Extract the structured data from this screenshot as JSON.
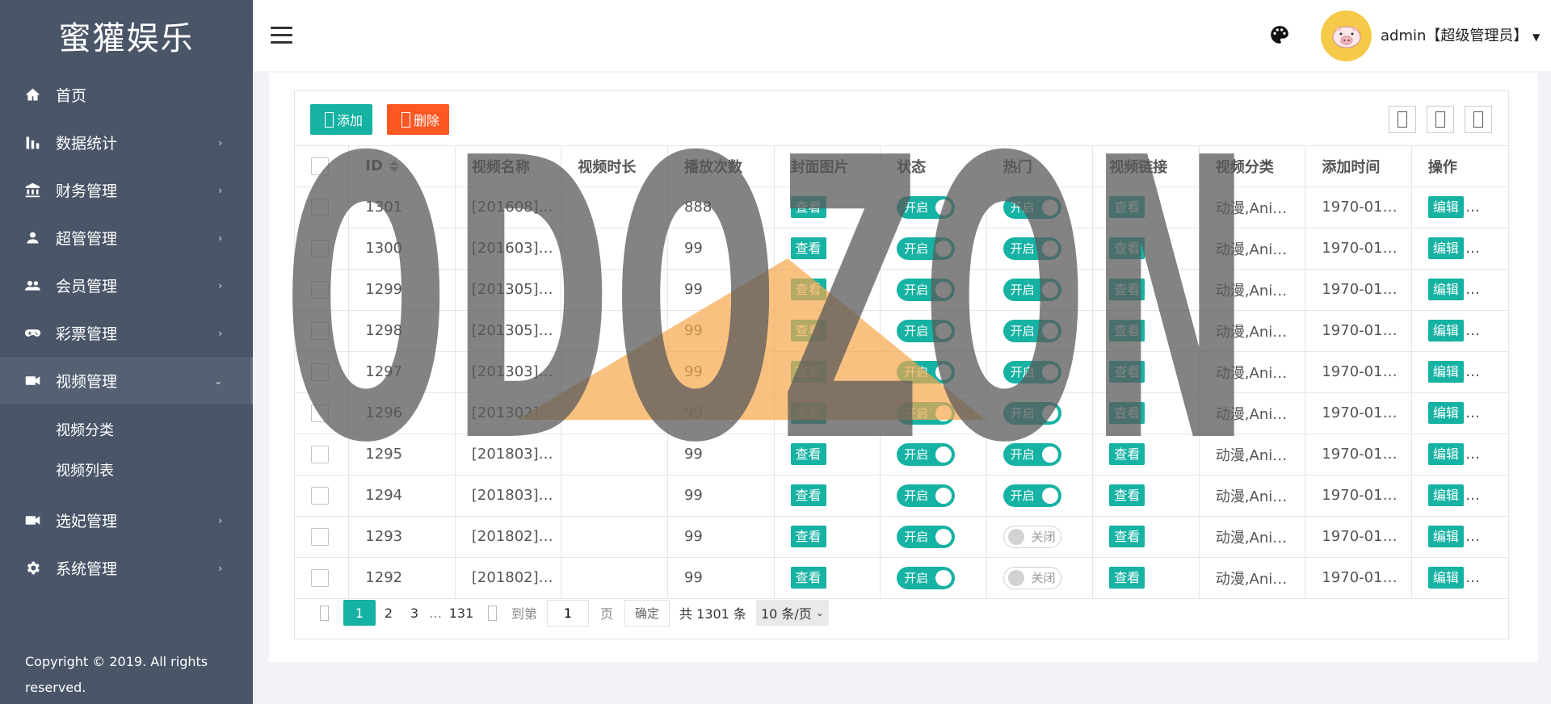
{
  "sidebar": {
    "brand": "蜜獾娱乐",
    "items": [
      {
        "label": "首页",
        "icon": "home-icon"
      },
      {
        "label": "数据统计",
        "icon": "bar-chart-icon"
      },
      {
        "label": "财务管理",
        "icon": "bank-icon"
      },
      {
        "label": "超管管理",
        "icon": "user-icon"
      },
      {
        "label": "会员管理",
        "icon": "users-icon"
      },
      {
        "label": "彩票管理",
        "icon": "gamepad-icon"
      },
      {
        "label": "视频管理",
        "icon": "video-icon"
      },
      {
        "label": "选妃管理",
        "icon": "video-icon"
      },
      {
        "label": "系统管理",
        "icon": "gear-icon"
      }
    ],
    "sub_items": [
      "视频分类",
      "视频列表"
    ],
    "copyright": "Copyright © 2019. All rights reserved."
  },
  "header": {
    "user": "admin【超级管理员】"
  },
  "toolbar": {
    "add_label": "添加",
    "delete_label": "删除"
  },
  "table": {
    "columns": [
      "ID",
      "视频名称",
      "视频时长",
      "播放次数",
      "封面图片",
      "状态",
      "热门",
      "视频链接",
      "视频分类",
      "添加时间",
      "操作"
    ],
    "view_label": "查看",
    "edit_label": "编辑",
    "on_label": "开启",
    "off_label": "关闭",
    "rows": [
      {
        "id": "1301",
        "name": "[201608]…",
        "duration": "",
        "plays": "888",
        "status": "开启",
        "hot": "开启",
        "category": "动漫,Ani…",
        "time": "1970-01…"
      },
      {
        "id": "1300",
        "name": "[201603]…",
        "duration": "",
        "plays": "99",
        "status": "开启",
        "hot": "开启",
        "category": "动漫,Ani…",
        "time": "1970-01…"
      },
      {
        "id": "1299",
        "name": "[201305]…",
        "duration": "",
        "plays": "99",
        "status": "开启",
        "hot": "开启",
        "category": "动漫,Ani…",
        "time": "1970-01…"
      },
      {
        "id": "1298",
        "name": "[201305]…",
        "duration": "",
        "plays": "99",
        "status": "开启",
        "hot": "开启",
        "category": "动漫,Ani…",
        "time": "1970-01…"
      },
      {
        "id": "1297",
        "name": "[201303]…",
        "duration": "",
        "plays": "99",
        "status": "开启",
        "hot": "开启",
        "category": "动漫,Ani…",
        "time": "1970-01…"
      },
      {
        "id": "1296",
        "name": "[201302]…",
        "duration": "",
        "plays": "99",
        "status": "开启",
        "hot": "开启",
        "category": "动漫,Ani…",
        "time": "1970-01…"
      },
      {
        "id": "1295",
        "name": "[201803]…",
        "duration": "",
        "plays": "99",
        "status": "开启",
        "hot": "开启",
        "category": "动漫,Ani…",
        "time": "1970-01…"
      },
      {
        "id": "1294",
        "name": "[201803]…",
        "duration": "",
        "plays": "99",
        "status": "开启",
        "hot": "开启",
        "category": "动漫,Ani…",
        "time": "1970-01…"
      },
      {
        "id": "1293",
        "name": "[201802]…",
        "duration": "",
        "plays": "99",
        "status": "开启",
        "hot": "关闭",
        "category": "动漫,Ani…",
        "time": "1970-01…"
      },
      {
        "id": "1292",
        "name": "[201802]…",
        "duration": "",
        "plays": "99",
        "status": "开启",
        "hot": "关闭",
        "category": "动漫,Ani…",
        "time": "1970-01…"
      }
    ]
  },
  "pagination": {
    "pages": [
      "1",
      "2",
      "3",
      "…",
      "131"
    ],
    "goto_label": "到第",
    "goto_value": "1",
    "page_unit": "页",
    "confirm_label": "确定",
    "total": "共 1301 条",
    "page_size": "10 条/页"
  },
  "watermark": {
    "text": "ODOZON"
  },
  "colors": {
    "sidebar": "#4a5568",
    "accent": "#16b2a3",
    "danger": "#ff5722"
  }
}
